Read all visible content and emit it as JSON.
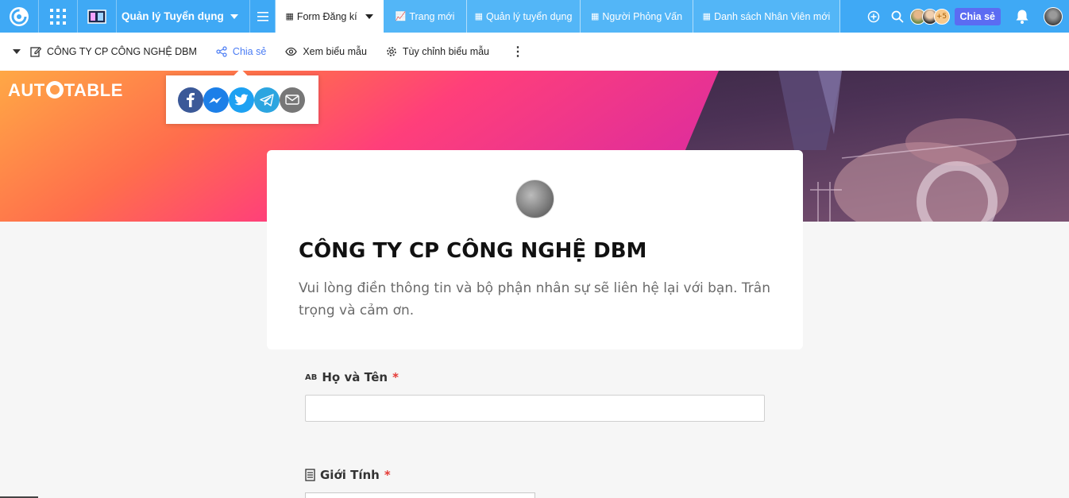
{
  "topbar": {
    "app_name": "Quản lý Tuyển dụng",
    "tabs": [
      {
        "label": "Form Đăng kí",
        "icon": "table-icon",
        "active": true
      },
      {
        "label": "Trang mới",
        "icon": "chart-icon",
        "active": false
      },
      {
        "label": "Quản lý tuyển dụng",
        "icon": "table-icon",
        "active": false
      },
      {
        "label": "Người Phỏng Vấn",
        "icon": "table-icon",
        "active": false
      },
      {
        "label": "Danh sách Nhân Viên mới",
        "icon": "table-icon",
        "active": false
      }
    ],
    "collaborator_count": "+5",
    "share_label": "Chia sẻ"
  },
  "toolbar": {
    "form_name": "CÔNG TY CP CÔNG NGHỆ DBM",
    "share": "Chia sẻ",
    "preview": "Xem biểu mẫu",
    "customize": "Tùy chỉnh biểu mẫu"
  },
  "banner": {
    "brand_left": "AUT",
    "brand_right": "TABLE"
  },
  "share_popup": {
    "networks": [
      "facebook-icon",
      "messenger-icon",
      "twitter-icon",
      "telegram-icon",
      "email-icon"
    ]
  },
  "form": {
    "title": "CÔNG TY CP CÔNG NGHỆ DBM",
    "description": "Vui lòng điền thông tin và bộ phận nhân sự sẽ liên hệ lại với bạn. Trân trọng và cảm ơn.",
    "fields": [
      {
        "label": "Họ và Tên",
        "required_mark": "*",
        "icon": "ab-icon",
        "value": ""
      },
      {
        "label": "Giới Tính",
        "required_mark": "*",
        "icon": "list-icon",
        "value": ""
      }
    ]
  },
  "colors": {
    "topbar": "#3fa9f5",
    "share_button": "#5b6cf2",
    "required": "#e53935",
    "share_link": "#4a7cf4"
  }
}
